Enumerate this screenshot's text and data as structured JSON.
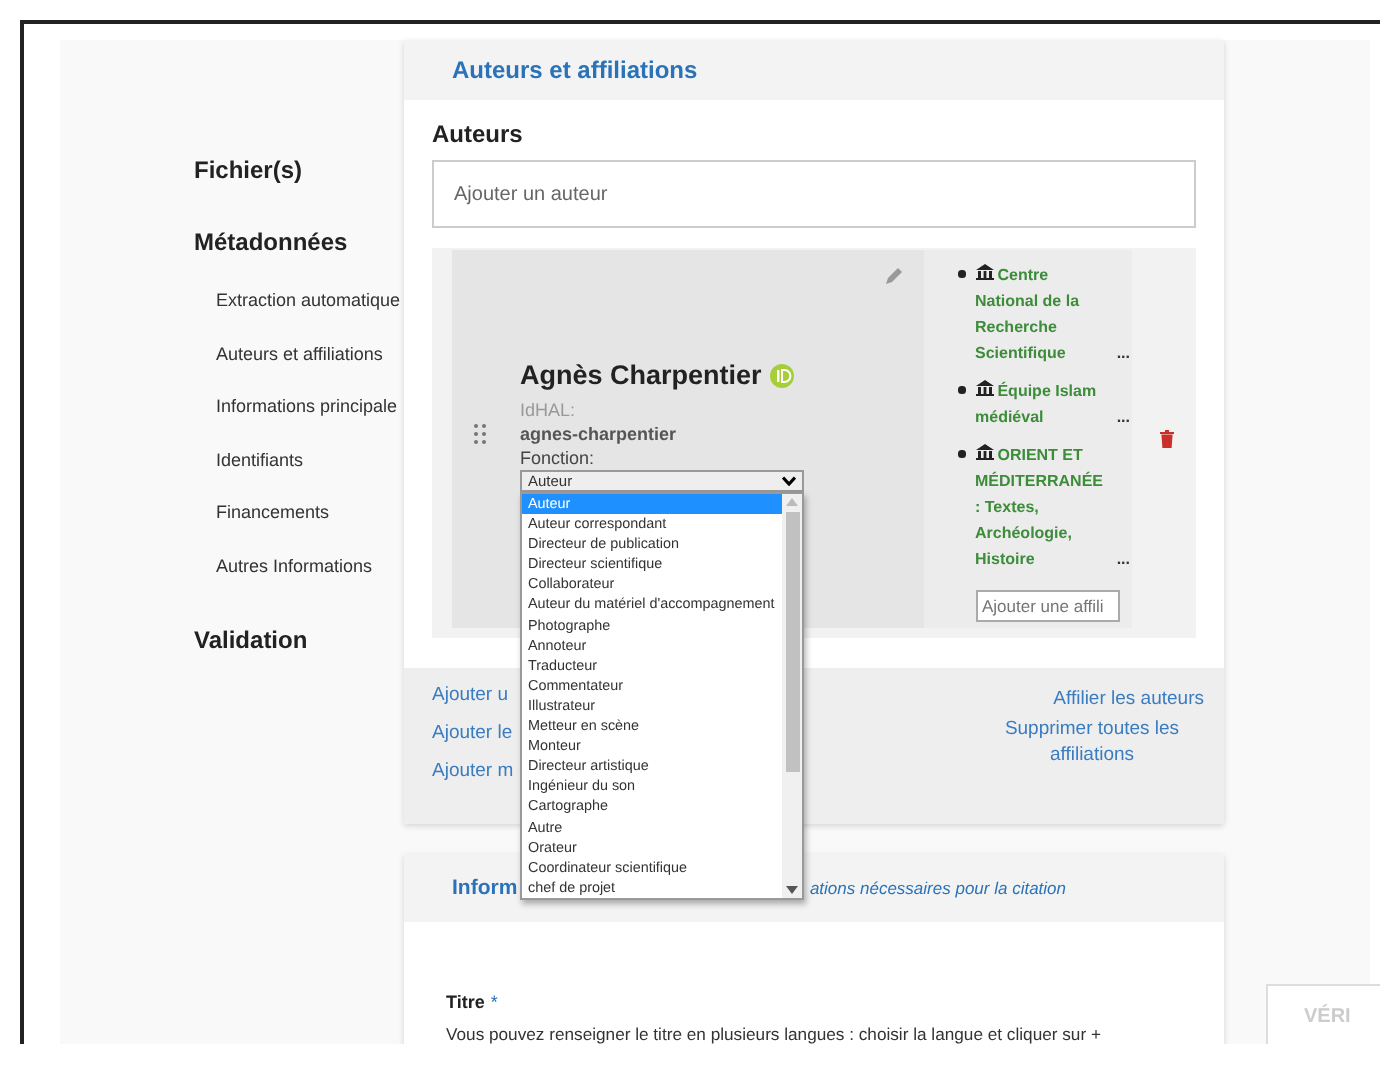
{
  "sidebar": {
    "sections": [
      {
        "label": "Fichier(s)"
      },
      {
        "label": "Métadonnées",
        "children": [
          {
            "label": "Extraction automatique"
          },
          {
            "label": "Auteurs et affiliations"
          },
          {
            "label": "Informations principale"
          },
          {
            "label": "Identifiants"
          },
          {
            "label": "Financements"
          },
          {
            "label": "Autres Informations"
          }
        ]
      },
      {
        "label": "Validation"
      }
    ]
  },
  "authors_section": {
    "title": "Auteurs et affiliations",
    "heading": "Auteurs",
    "search": {
      "placeholder": "Ajouter un auteur"
    },
    "author": {
      "name": "Agnès Charpentier",
      "idhal_label": "IdHAL:",
      "idhal": "agnes-charpentier",
      "function_label": "Fonction:",
      "function_select": {
        "value": "Auteur",
        "expanded": true,
        "options": [
          {
            "label": "Auteur",
            "selected": true
          },
          {
            "label": "Auteur correspondant",
            "selected": false
          },
          {
            "label": "Directeur de publication",
            "selected": false
          },
          {
            "label": "Directeur scientifique",
            "selected": false
          },
          {
            "label": "Collaborateur",
            "selected": false
          },
          {
            "label": "Auteur du matériel d'accompagnement",
            "selected": false
          },
          {
            "label": "Photographe",
            "selected": false
          },
          {
            "label": "Annoteur",
            "selected": false
          },
          {
            "label": "Traducteur",
            "selected": false
          },
          {
            "label": "Commentateur",
            "selected": false
          },
          {
            "label": "Illustrateur",
            "selected": false
          },
          {
            "label": "Metteur en scène",
            "selected": false
          },
          {
            "label": "Monteur",
            "selected": false
          },
          {
            "label": "Directeur artistique",
            "selected": false
          },
          {
            "label": "Ingénieur du son",
            "selected": false
          },
          {
            "label": "Cartographe",
            "selected": false
          },
          {
            "label": "Autre",
            "selected": false
          },
          {
            "label": "Orateur",
            "selected": false
          },
          {
            "label": "Coordinateur scientifique",
            "selected": false
          },
          {
            "label": "chef de projet",
            "selected": false
          }
        ]
      },
      "affiliations": [
        {
          "name": "Centre National de la Recherche Scientifique",
          "more": "..."
        },
        {
          "name": "Équipe Islam médiéval",
          "more": "..."
        },
        {
          "name": "ORIENT ET MÉDITERRANÉE : Textes, Archéologie, Histoire",
          "more": "..."
        }
      ],
      "affiliation_input": {
        "placeholder": "Ajouter une affili"
      }
    },
    "actions_left": [
      "Ajouter u",
      "Ajouter le",
      "Ajouter m"
    ],
    "actions_right": [
      "Affilier les auteurs",
      "Supprimer toutes les affiliations"
    ]
  },
  "info_section": {
    "title": "Inform",
    "subtitle": "ations nécessaires pour la citation",
    "field_label": "Titre",
    "required_mark": "*",
    "help": "Vous pouvez renseigner le titre en plusieurs langues : choisir la langue et cliquer sur +"
  },
  "verify_button": "VÉRI"
}
